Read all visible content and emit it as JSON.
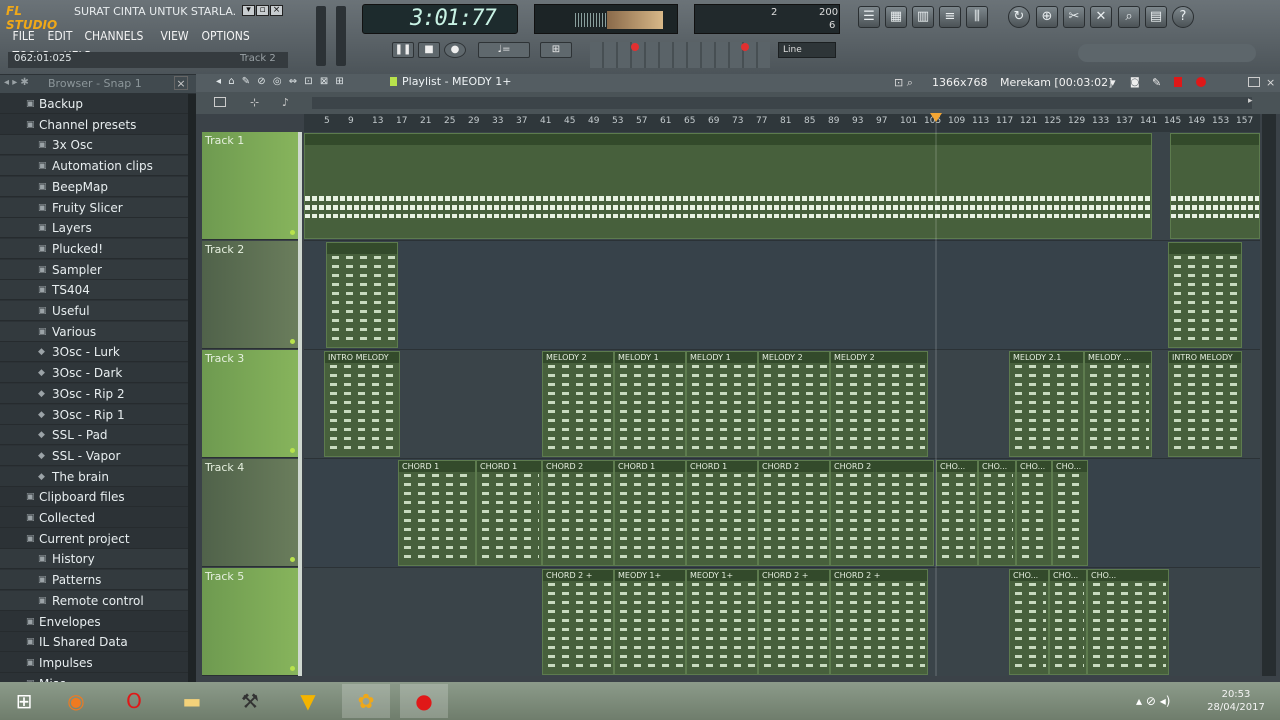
{
  "app": {
    "logo": "FL STUDIO",
    "song_title": "SURAT CINTA UNTUK STARLA.flp"
  },
  "menu": [
    "FILE",
    "EDIT",
    "CHANNELS",
    "VIEW",
    "OPTIONS",
    "TOOLS",
    "HELP"
  ],
  "status": {
    "song_position": "062:01:025",
    "hint": "Track 2"
  },
  "transport": {
    "time": "3:01:77",
    "meter_a": "2",
    "meter_b": "200",
    "meter_c": "6",
    "snap": "Line"
  },
  "browser": {
    "title": "Browser - Snap 1",
    "items": [
      {
        "label": "Backup",
        "level": 1
      },
      {
        "label": "Channel presets",
        "level": 1
      },
      {
        "label": "3x Osc",
        "level": 2
      },
      {
        "label": "Automation clips",
        "level": 2
      },
      {
        "label": "BeepMap",
        "level": 2
      },
      {
        "label": "Fruity Slicer",
        "level": 2
      },
      {
        "label": "Layers",
        "level": 2
      },
      {
        "label": "Plucked!",
        "level": 2
      },
      {
        "label": "Sampler",
        "level": 2
      },
      {
        "label": "TS404",
        "level": 2
      },
      {
        "label": "Useful",
        "level": 2
      },
      {
        "label": "Various",
        "level": 2
      },
      {
        "label": "3Osc - Lurk",
        "level": 3
      },
      {
        "label": "3Osc - Dark",
        "level": 3
      },
      {
        "label": "3Osc - Rip 2",
        "level": 3
      },
      {
        "label": "3Osc - Rip 1",
        "level": 3
      },
      {
        "label": "SSL - Pad",
        "level": 3
      },
      {
        "label": "SSL - Vapor",
        "level": 3
      },
      {
        "label": "The brain",
        "level": 3
      },
      {
        "label": "Clipboard files",
        "level": 1
      },
      {
        "label": "Collected",
        "level": 1
      },
      {
        "label": "Current project",
        "level": 1
      },
      {
        "label": "History",
        "level": 2
      },
      {
        "label": "Patterns",
        "level": 2
      },
      {
        "label": "Remote control",
        "level": 2
      },
      {
        "label": "Envelopes",
        "level": 1
      },
      {
        "label": "IL Shared Data",
        "level": 1
      },
      {
        "label": "Impulses",
        "level": 1
      },
      {
        "label": "Misc",
        "level": 1
      }
    ]
  },
  "playlist": {
    "title": "Playlist - MEODY 1+",
    "resolution": "1366x768",
    "recording": "Merekam [00:03:02]",
    "ruler": [
      "5",
      "9",
      "13",
      "17",
      "21",
      "25",
      "29",
      "33",
      "37",
      "41",
      "45",
      "49",
      "53",
      "57",
      "61",
      "65",
      "69",
      "73",
      "77",
      "81",
      "85",
      "89",
      "93",
      "97",
      "101",
      "105",
      "109",
      "113",
      "117",
      "121",
      "125",
      "129",
      "133",
      "137",
      "141",
      "145",
      "149",
      "153",
      "157"
    ],
    "tracks": [
      "Track 1",
      "Track 2",
      "Track 3",
      "Track 4",
      "Track 5"
    ],
    "clips_track3": [
      "INTRO MELODY",
      "MELODY 2",
      "MELODY 1",
      "MELODY 1",
      "MELODY 2",
      "MELODY 2",
      "MELODY 2.1",
      "MELODY ...",
      "INTRO MELODY"
    ],
    "clips_track4": [
      "CHORD 1",
      "CHORD 1",
      "CHORD 2",
      "CHORD 1",
      "CHORD 1",
      "CHORD 2",
      "CHORD 2",
      "CHO...",
      "CHO...",
      "CHO...",
      "CHO..."
    ],
    "clips_track5": [
      "CHORD 2 +",
      "MEODY 1+",
      "MEODY 1+",
      "CHORD 2 +",
      "CHORD 2 +",
      "CHO...",
      "CHO...",
      "CHO..."
    ]
  },
  "taskbar": {
    "time": "20:53",
    "date": "28/04/2017"
  },
  "colors": {
    "accent": "#f0a818",
    "track_green": "#87b45c",
    "clip_green": "#47603c",
    "record": "#e01818"
  }
}
